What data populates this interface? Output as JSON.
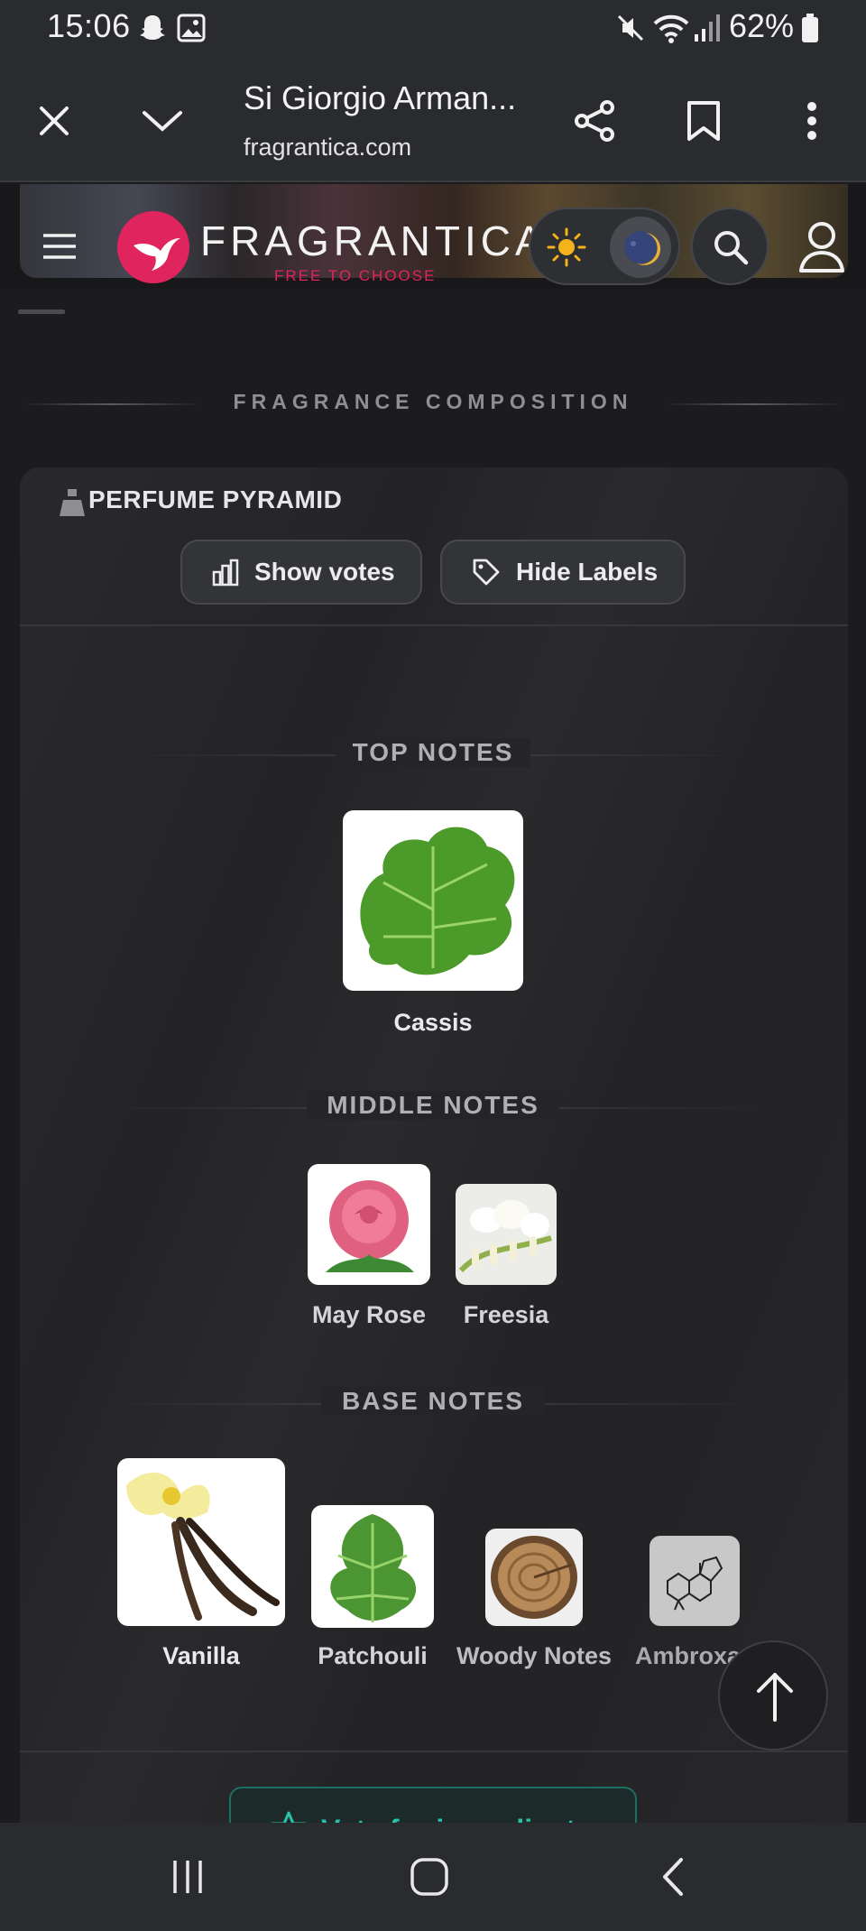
{
  "status_bar": {
    "time": "15:06",
    "battery_percent": "62%",
    "icons": [
      "snapchat-notification-icon",
      "gallery-notification-icon",
      "vibrate-mute-icon",
      "wifi-icon",
      "signal-icon",
      "battery-icon"
    ]
  },
  "browser": {
    "page_title": "Si Giorgio Arman...",
    "domain": "fragrantica.com",
    "actions": [
      "close-icon",
      "chevron-down-icon",
      "share-icon",
      "bookmark-icon",
      "more-vert-icon"
    ]
  },
  "site_header": {
    "brand": "FRAGRANTICA",
    "tagline": "FREE TO CHOOSE",
    "brand_color": "#e0245e"
  },
  "composition": {
    "section_heading": "FRAGRANCE COMPOSITION",
    "card_title": "PERFUME PYRAMID",
    "show_votes_label": "Show votes",
    "hide_labels_label": "Hide Labels",
    "top_notes_label": "TOP NOTES",
    "middle_notes_label": "MIDDLE NOTES",
    "base_notes_label": "BASE NOTES",
    "top_notes": [
      {
        "name": "Cassis"
      }
    ],
    "middle_notes": [
      {
        "name": "May Rose"
      },
      {
        "name": "Freesia"
      }
    ],
    "base_notes": [
      {
        "name": "Vanilla"
      },
      {
        "name": "Patchouli"
      },
      {
        "name": "Woody Notes"
      },
      {
        "name": "Ambroxan"
      }
    ],
    "vote_button_label": "Vote for ingredients"
  },
  "colors": {
    "accent_teal": "#28c2aa",
    "background": "#1c1c1f"
  }
}
